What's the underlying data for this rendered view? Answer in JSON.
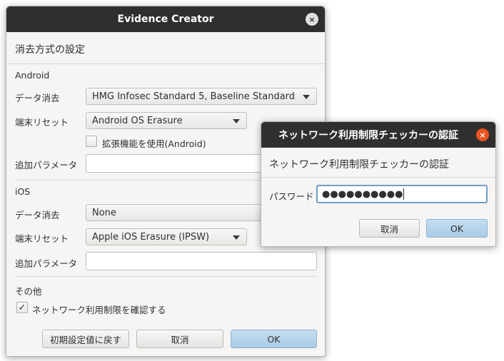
{
  "main_dialog": {
    "title": "Evidence Creator",
    "close_icon": "×",
    "heading": "消去方式の設定",
    "android": {
      "section_label": "Android",
      "erase_label": "データ消去",
      "erase_value": "HMG Infosec Standard 5, Baseline Standard",
      "reset_label": "端末リセット",
      "reset_value": "Android OS Erasure",
      "extension_label": "拡張機能を使用(Android)",
      "extension_checked": false,
      "params_label": "追加パラメータ",
      "params_value": ""
    },
    "ios": {
      "section_label": "iOS",
      "erase_label": "データ消去",
      "erase_value": "None",
      "reset_label": "端末リセット",
      "reset_value": "Apple iOS Erasure (IPSW)",
      "params_label": "追加パラメータ",
      "params_value": ""
    },
    "other": {
      "section_label": "その他",
      "network_check_label": "ネットワーク利用制限を確認する",
      "network_check_checked": true,
      "check_glyph": "✓"
    },
    "buttons": {
      "reset_label": "初期設定値に戻す",
      "cancel_label": "取消",
      "ok_label": "OK"
    }
  },
  "auth_dialog": {
    "title": "ネットワーク利用制限チェッカーの認証",
    "close_icon": "×",
    "heading": "ネットワーク利用制限チェッカーの認証",
    "password_label": "パスワード",
    "password_value": "●●●●●●●●●●",
    "buttons": {
      "cancel_label": "取消",
      "ok_label": "OK"
    }
  },
  "colors": {
    "titlebar_bg": "#2f2f2f",
    "close_main_bg": "#e0e0e0",
    "close_auth_bg": "#e95420",
    "ok_button_bg": "#a8cbe6",
    "focus_border": "#6d9ec6"
  }
}
